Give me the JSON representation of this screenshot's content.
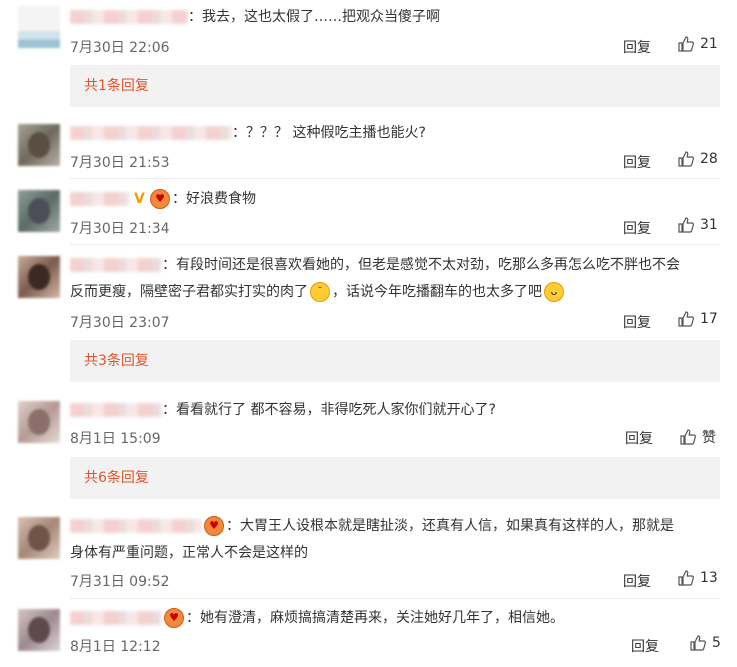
{
  "comments": [
    {
      "text": "我去，这也太假了……把观众当傻子啊",
      "time": "7月30日 22:06",
      "reply": "回复",
      "likes": "21"
    },
    {
      "text": "？？？ 这种假吃主播也能火?",
      "time": "7月30日 21:53",
      "reply": "回复",
      "likes": "28"
    },
    {
      "text": "好浪费食物",
      "time": "7月30日 21:34",
      "reply": "回复",
      "likes": "31"
    },
    {
      "text1": "有段时间还是很喜欢看她的，但老是感觉不太对劲，吃那么多再怎么吃不胖也不会",
      "text2a": "反而更瘦，隔壁密子君都实打实的肉了",
      "text2b": "，话说今年吃播翻车的也太多了吧",
      "time": "7月30日 23:07",
      "reply": "回复",
      "likes": "17"
    },
    {
      "text": "看看就行了 都不容易，非得吃死人家你们就开心了?",
      "time": "8月1日 15:09",
      "reply": "回复",
      "likes": "赞"
    },
    {
      "text1": "大胃王人设根本就是瞎扯淡，还真有人信，如果真有这样的人，那就是",
      "text2": "身体有严重问题，正常人不会是这样的",
      "time": "7月31日 09:52",
      "reply": "回复",
      "likes": "13"
    },
    {
      "text": "她有澄清，麻烦搞搞清楚再来，关注她好几年了，相信她。",
      "time": "8月1日 12:12",
      "reply": "回复",
      "likes": "5"
    }
  ],
  "more_replies": [
    "共1条回复",
    "共3条回复",
    "共6条回复"
  ],
  "colon": "：",
  "icons": {
    "like": "thumb-up-icon",
    "verified": "verified-badge-icon",
    "emoji": "emoji-icon"
  },
  "colors": {
    "accent": "#e0562c",
    "box_bg": "#f2f2f2",
    "meta": "#666666"
  }
}
